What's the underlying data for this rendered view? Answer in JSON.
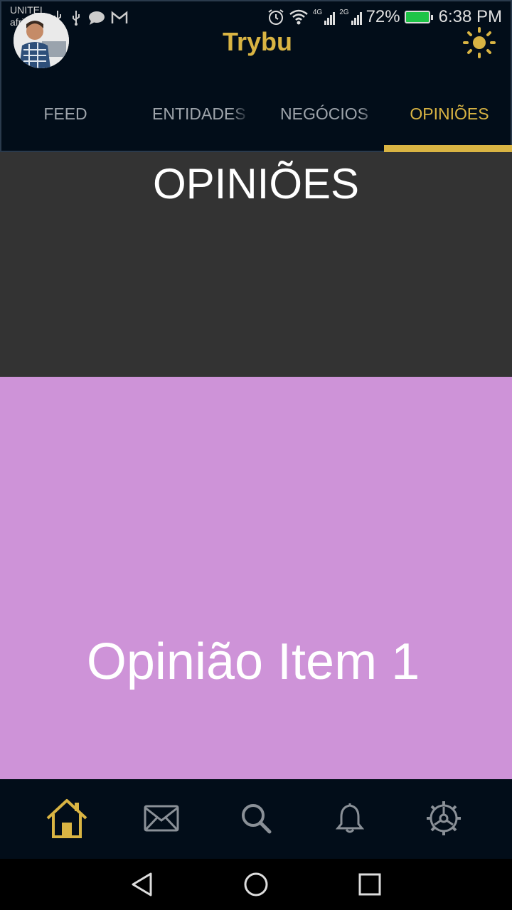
{
  "status_bar": {
    "carrier_1": "UNITEL",
    "carrier_2": "africell",
    "network_1": "4G",
    "network_2": "2G",
    "battery": "72%",
    "time": "6:38 PM"
  },
  "app_bar": {
    "title": "Trybu",
    "theme_icon": "sun-icon",
    "avatar_icon": "user-avatar"
  },
  "tabs": [
    {
      "label": "FEED",
      "active": false
    },
    {
      "label": "ENTIDADES",
      "active": false
    },
    {
      "label": "NEGÓCIOS",
      "active": false
    },
    {
      "label": "OPINIÕES",
      "active": true
    }
  ],
  "page": {
    "header": "OPINIÕES"
  },
  "list": {
    "items": [
      {
        "label": "Opinião Item 1"
      }
    ]
  },
  "bottom_nav": {
    "items": [
      {
        "icon": "home-icon",
        "active": true
      },
      {
        "icon": "mail-icon",
        "active": false
      },
      {
        "icon": "search-icon",
        "active": false
      },
      {
        "icon": "bell-icon",
        "active": false
      },
      {
        "icon": "settings-icon",
        "active": false
      }
    ]
  },
  "system_nav": [
    "back-icon",
    "home-circle-icon",
    "recents-icon"
  ],
  "colors": {
    "accent": "#d9b443",
    "app_bar_bg": "#020d19",
    "header_bg": "#333333",
    "item_bg": "#ce93d8"
  }
}
